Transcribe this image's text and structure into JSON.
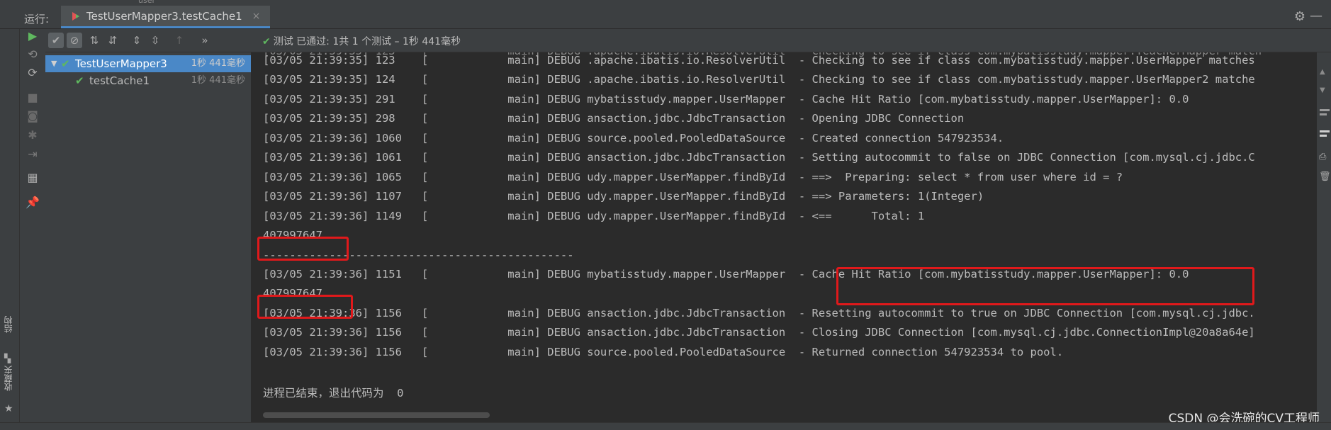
{
  "header": {
    "fragment_top": "user"
  },
  "run_panel": {
    "label": "运行:",
    "tab_title": "TestUserMapper3.testCache1",
    "tab_close": "×"
  },
  "toolbar": {
    "status_check": "✔",
    "status": "测试 已通过: 1共 1 个测试 – 1秒 441毫秒"
  },
  "tree": {
    "items": [
      {
        "name": "TestUserMapper3",
        "time": "1秒 441毫秒",
        "selected": true
      },
      {
        "name": "testCache1",
        "time": "1秒 441毫秒",
        "selected": false
      }
    ]
  },
  "console": {
    "lines": [
      "[03/05 21:39:35] 123    [            main] DEBUG .apache.ibatis.io.ResolverUtil  - Checking to see if class com.mybatisstudy.mapper.UserMapper matches",
      "[03/05 21:39:35] 124    [            main] DEBUG .apache.ibatis.io.ResolverUtil  - Checking to see if class com.mybatisstudy.mapper.UserMapper2 matche",
      "[03/05 21:39:35] 291    [            main] DEBUG mybatisstudy.mapper.UserMapper  - Cache Hit Ratio [com.mybatisstudy.mapper.UserMapper]: 0.0",
      "[03/05 21:39:35] 298    [            main] DEBUG ansaction.jdbc.JdbcTransaction  - Opening JDBC Connection",
      "[03/05 21:39:36] 1060   [            main] DEBUG source.pooled.PooledDataSource  - Created connection 547923534.",
      "[03/05 21:39:36] 1061   [            main] DEBUG ansaction.jdbc.JdbcTransaction  - Setting autocommit to false on JDBC Connection [com.mysql.cj.jdbc.C",
      "[03/05 21:39:36] 1065   [            main] DEBUG udy.mapper.UserMapper.findById  - ==>  Preparing: select * from user where id = ?",
      "[03/05 21:39:36] 1107   [            main] DEBUG udy.mapper.UserMapper.findById  - ==> Parameters: 1(Integer)",
      "[03/05 21:39:36] 1149   [            main] DEBUG udy.mapper.UserMapper.findById  - <==      Total: 1",
      "407997647",
      "-----------------------------------------------",
      "[03/05 21:39:36] 1151   [            main] DEBUG mybatisstudy.mapper.UserMapper  - Cache Hit Ratio [com.mybatisstudy.mapper.UserMapper]: 0.0",
      "407997647",
      "[03/05 21:39:36] 1156   [            main] DEBUG ansaction.jdbc.JdbcTransaction  - Resetting autocommit to true on JDBC Connection [com.mysql.cj.jdbc.",
      "[03/05 21:39:36] 1156   [            main] DEBUG ansaction.jdbc.JdbcTransaction  - Closing JDBC Connection [com.mysql.cj.jdbc.ConnectionImpl@20a8a64e]",
      "[03/05 21:39:36] 1156   [            main] DEBUG source.pooled.PooledDataSource  - Returned connection 547923534 to pool.",
      "",
      "进程已结束，退出代码为  0"
    ]
  },
  "side_labels": {
    "structure": "结构",
    "favorites": "收藏夹"
  },
  "watermark": "CSDN @会洗碗的CV工程师",
  "colors": {
    "background": "#2b2b2b",
    "panel": "#3c3f41",
    "selection": "#4a88c7",
    "pass_green": "#5fb85f",
    "highlight_red": "#e0191b"
  }
}
